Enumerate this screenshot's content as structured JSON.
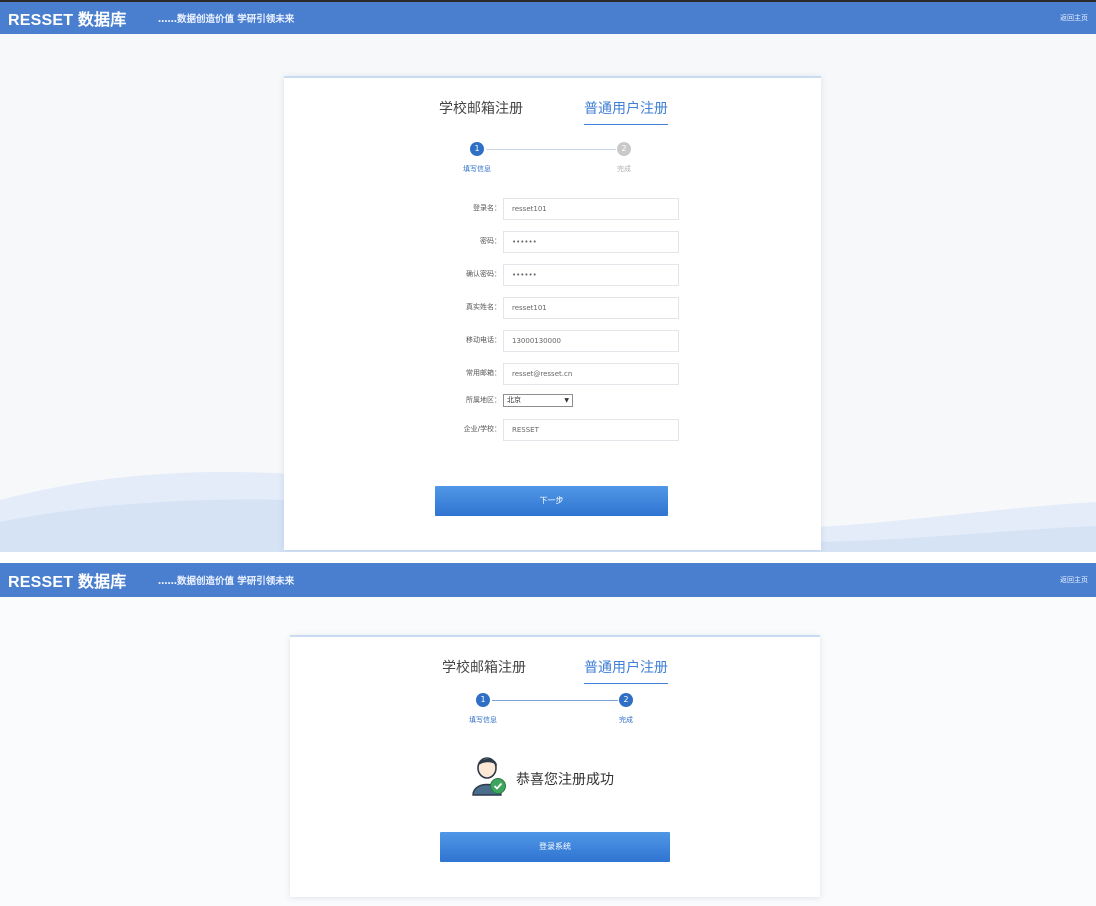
{
  "colors": {
    "header": "#4a7fd0",
    "accent": "#3f7fd6",
    "step": "#2f6fc6"
  },
  "header": {
    "brand": "RESSET 数据库",
    "slogan": "……数据创造价值 学研引领未来",
    "home_link": "返回主页"
  },
  "tabs": {
    "school": "学校邮箱注册",
    "normal": "普通用户注册"
  },
  "steps": {
    "one": "1",
    "two": "2",
    "fill_info": "填写信息",
    "done": "完成"
  },
  "form": {
    "login_label": "登录名：",
    "login_value": "resset101",
    "password_label": "密码：",
    "password_value": "••••••",
    "confirm_label": "确认密码：",
    "confirm_value": "••••••",
    "realname_label": "真实姓名：",
    "realname_value": "resset101",
    "phone_label": "移动电话：",
    "phone_value": "13000130000",
    "email_label": "常用邮箱：",
    "email_value": "resset@resset.cn",
    "region_label": "所属地区：",
    "region_value": "北京",
    "company_label": "企业/学校：",
    "company_value": "RESSET"
  },
  "buttons": {
    "next": "下一步",
    "login": "登录系统"
  },
  "success": {
    "message": "恭喜您注册成功",
    "icon": "user-check-icon"
  }
}
